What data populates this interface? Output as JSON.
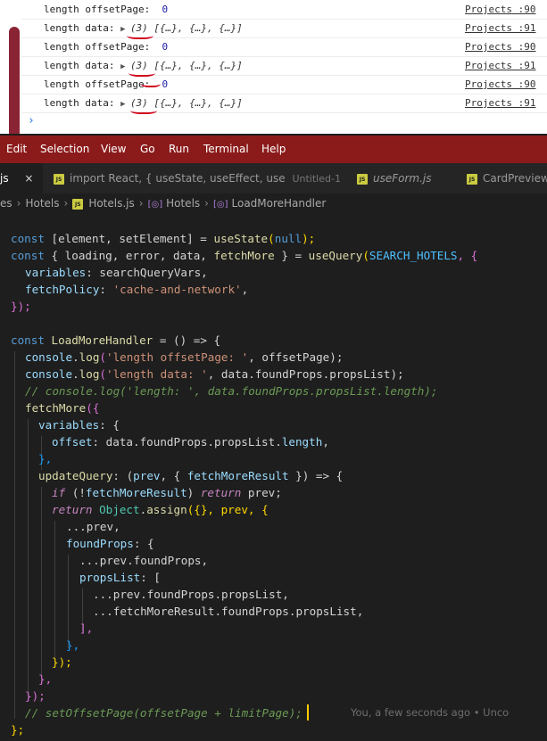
{
  "console": {
    "rows": [
      {
        "label": "length offsetPage: ",
        "value": "0",
        "source": "Projects :90"
      },
      {
        "label": "length data: ",
        "value": "(3) [{…}, {…}, {…}]",
        "source": "Projects :91"
      },
      {
        "label": "length offsetPage: ",
        "value": "0",
        "source": "Projects :90"
      },
      {
        "label": "length data: ",
        "value": "(3) [{…}, {…}, {…}]",
        "source": "Projects :91"
      },
      {
        "label": "length offsetPage: ",
        "value": "0",
        "source": "Projects :90"
      },
      {
        "label": "length data: ",
        "value": "(3) [{…}, {…}, {…}]",
        "source": "Projects :91"
      }
    ],
    "prompt": "›"
  },
  "menubar": [
    "Edit",
    "Selection",
    "View",
    "Go",
    "Run",
    "Terminal",
    "Help"
  ],
  "tabs": [
    {
      "label": "js",
      "active": true,
      "close": "×"
    },
    {
      "label": "import React, { useState, useEffect, use",
      "sublabel": "Untitled-1",
      "active": false
    },
    {
      "label": "useForm.js",
      "active": false
    },
    {
      "label": "CardPreview.",
      "active": false
    }
  ],
  "breadcrumb": [
    "es",
    "Hotels",
    "Hotels.js",
    "Hotels",
    "LoadMoreHandler"
  ],
  "blame": "You, a few seconds ago • Unco",
  "code": {
    "l1": [
      "const",
      " [element, setElement] = ",
      "useState",
      "(",
      "null",
      ");"
    ],
    "l2": [
      "const",
      " { loading, error, data, ",
      "fetchMore",
      " } = ",
      "useQuery",
      "(",
      "SEARCH_HOTELS",
      ", {"
    ],
    "l3": [
      "variables",
      ": searchQueryVars,"
    ],
    "l4": [
      "fetchPolicy",
      ": ",
      "'cache-and-network'",
      ","
    ],
    "l5": [
      "});"
    ],
    "l6": [
      "const",
      " ",
      "LoadMoreHandler",
      " = () => {"
    ],
    "l7": [
      "console",
      ".",
      "log",
      "(",
      "'length offsetPage: '",
      ", offsetPage);"
    ],
    "l8": [
      "console",
      ".",
      "log",
      "(",
      "'length data: '",
      ", data.foundProps.propsList);"
    ],
    "l9": "// console.log('length: ', data.foundProps.propsList.length);",
    "l10": [
      "fetchMore",
      "({"
    ],
    "l11": [
      "variables",
      ": {"
    ],
    "l12": [
      "offset",
      ": data.foundProps.propsList.",
      "length",
      ","
    ],
    "l13": [
      "},"
    ],
    "l14": [
      "updateQuery",
      ": (",
      "prev",
      ", { ",
      "fetchMoreResult",
      " }) => {"
    ],
    "l15": [
      "if",
      " (!",
      "fetchMoreResult",
      ") ",
      "return",
      " prev;"
    ],
    "l16": [
      "return",
      " ",
      "Object",
      ".",
      "assign",
      "({}, prev, {"
    ],
    "l17": [
      "...prev,"
    ],
    "l18": [
      "foundProps",
      ": {"
    ],
    "l19": [
      "...prev.foundProps,"
    ],
    "l20": [
      "propsList",
      ": ["
    ],
    "l21": [
      "...prev.foundProps.propsList,"
    ],
    "l22": [
      "...fetchMoreResult.foundProps.propsList,"
    ],
    "l23": [
      "],"
    ],
    "l24": [
      "},"
    ],
    "l25": [
      "});"
    ],
    "l26": [
      "},"
    ],
    "l27": [
      "});"
    ],
    "l28": "// setOffsetPage(offsetPage + limitPage);",
    "l29": [
      "};"
    ]
  }
}
